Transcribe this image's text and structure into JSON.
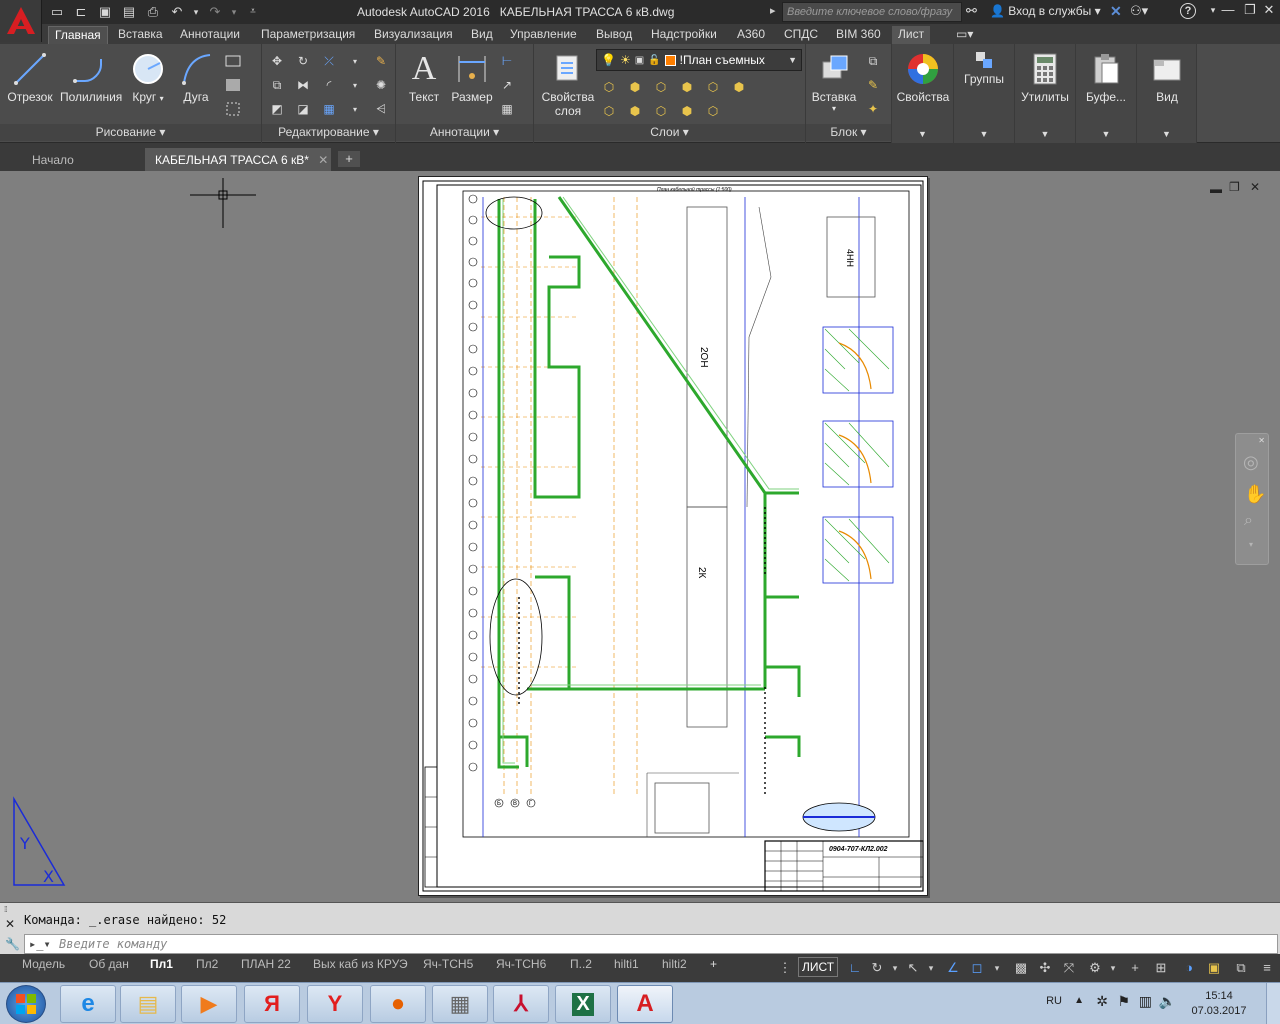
{
  "window": {
    "app_title": "Autodesk AutoCAD 2016",
    "file_title": "КАБЕЛЬНАЯ ТРАССА 6 кВ.dwg",
    "search_placeholder": "Введите ключевое слово/фразу",
    "login_label": "Вход в службы"
  },
  "ribbon_tabs": [
    "Главная",
    "Вставка",
    "Аннотации",
    "Параметризация",
    "Визуализация",
    "Вид",
    "Управление",
    "Вывод",
    "Надстройки",
    "A360",
    "СПДС",
    "BIM 360",
    "Лист"
  ],
  "ribbon": {
    "draw": {
      "title": "Рисование",
      "items": [
        "Отрезок",
        "Полилиния",
        "Круг",
        "Дуга"
      ]
    },
    "modify": {
      "title": "Редактирование"
    },
    "annotation": {
      "title": "Аннотации",
      "items": [
        "Текст",
        "Размер"
      ]
    },
    "layers": {
      "title": "Слои",
      "props_label_1": "Свойства",
      "props_label_2": "слоя",
      "current_layer": "!План съемных"
    },
    "block": {
      "title": "Блок",
      "insert_label": "Вставка"
    },
    "properties": "Свойства",
    "groups": "Группы",
    "utilities": "Утилиты",
    "clipboard": "Буфе...",
    "view": "Вид"
  },
  "file_tabs": [
    "Начало",
    "КАБЕЛЬНАЯ ТРАССА 6 кВ*"
  ],
  "drawing": {
    "plan_note": "План кабельной трассы (1:500)",
    "building_label_1": "2ОН",
    "building_label_2": "2К",
    "building_label_3": "4НН",
    "stamp_code": "0904-707-КЛ2.002",
    "axis_labels": [
      "Б",
      "В",
      "Г"
    ]
  },
  "command": {
    "history": "Команда: _.erase найдено: 52",
    "placeholder": "Введите команду"
  },
  "layout_tabs": [
    "Модель",
    "Об дан",
    "Пл1",
    "Пл2",
    "ПЛАН 22",
    "Вых каб из КРУЭ",
    "Яч-ТСН5",
    "Яч-ТСН6",
    "П..2",
    "hilti1",
    "hilti2"
  ],
  "status": {
    "space_label": "ЛИСТ"
  },
  "taskbar": {
    "lang": "RU",
    "time": "15:14",
    "date": "07.03.2017"
  }
}
